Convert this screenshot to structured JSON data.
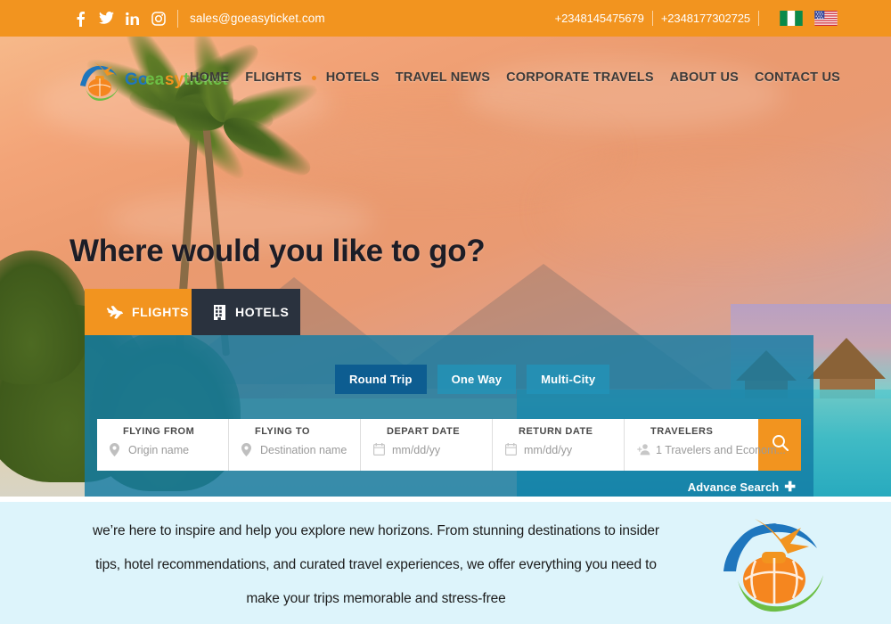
{
  "topbar": {
    "social": [
      {
        "name": "facebook-icon",
        "label": "Facebook"
      },
      {
        "name": "twitter-icon",
        "label": "Twitter"
      },
      {
        "name": "linkedin-icon",
        "label": "LinkedIn"
      },
      {
        "name": "instagram-icon",
        "label": "Instagram"
      }
    ],
    "email": "sales@goeasyticket.com",
    "phone1": "+2348145475679",
    "phone2": "+2348177302725",
    "flags": [
      "Nigeria",
      "United States"
    ],
    "bg_color": "#f2941f"
  },
  "header": {
    "logo_text": "GoEasyTicket",
    "nav": [
      {
        "label": "HOME",
        "dropdown": false
      },
      {
        "label": "FLIGHTS",
        "dropdown": true
      },
      {
        "label": "HOTELS",
        "dropdown": false
      },
      {
        "label": "TRAVEL NEWS",
        "dropdown": false
      },
      {
        "label": "CORPORATE TRAVELS",
        "dropdown": false
      },
      {
        "label": "ABOUT US",
        "dropdown": false
      },
      {
        "label": "CONTACT US",
        "dropdown": false
      }
    ]
  },
  "hero": {
    "headline": "Where would you like to go?"
  },
  "booking": {
    "tabs": [
      {
        "label": "FLIGHTS",
        "icon": "plane-icon",
        "active": true
      },
      {
        "label": "HOTELS",
        "icon": "building-icon",
        "active": false
      }
    ],
    "trip_types": [
      {
        "label": "Round Trip",
        "active": true
      },
      {
        "label": "One Way",
        "active": false
      },
      {
        "label": "Multi-City",
        "active": false
      }
    ],
    "fields": [
      {
        "label": "FLYING FROM",
        "value": "Origin name",
        "icon": "location-pin-icon"
      },
      {
        "label": "FLYING TO",
        "value": "Destination name",
        "icon": "location-pin-icon"
      },
      {
        "label": "DEPART DATE",
        "value": "mm/dd/yy",
        "icon": "calendar-icon"
      },
      {
        "label": "RETURN DATE",
        "value": "mm/dd/yy",
        "icon": "calendar-icon"
      },
      {
        "label": "TRAVELERS",
        "value": "1 Travelers and Econom...",
        "icon": "travelers-icon"
      }
    ],
    "search_icon": "search-icon",
    "advance_search": "Advance Search",
    "advance_search_plus": "✚",
    "accent_color": "#f2941f",
    "panel_color": "#147da5"
  },
  "bottom": {
    "paragraph": "we’re here to inspire and help you explore new horizons. From stunning destinations to insider tips, hotel recommendations, and curated travel experiences, we offer everything you need to make your trips memorable and stress-free",
    "bg_color": "#ddf4fb",
    "logo": "goeasyticket-logo"
  }
}
